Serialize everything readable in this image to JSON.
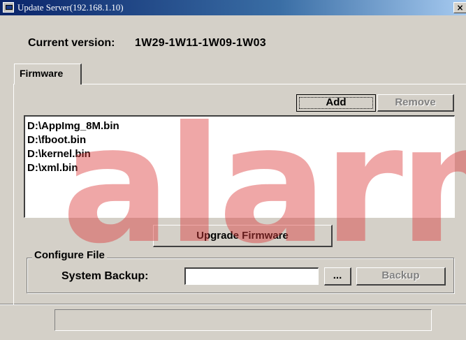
{
  "window": {
    "title": "Update Server(192.168.1.10)",
    "close_glyph": "×"
  },
  "version": {
    "label": "Current version:",
    "value": "1W29-1W11-1W09-1W03"
  },
  "tabs": [
    {
      "label": "Firmware",
      "selected": true
    }
  ],
  "firmware": {
    "add_label": "Add",
    "remove_label": "Remove",
    "files": [
      "D:\\AppImg_8M.bin",
      "D:\\fboot.bin",
      "D:\\kernel.bin",
      "D:\\xml.bin"
    ],
    "upgrade_label": "Upgrade Firmware"
  },
  "configure": {
    "group_label": "Configure File",
    "system_backup_label": "System Backup:",
    "system_backup_value": "",
    "browse_label": "...",
    "backup_label": "Backup"
  },
  "watermark": {
    "text": "alarm",
    "color": "#dc3c3c"
  },
  "status": {
    "text": ""
  }
}
